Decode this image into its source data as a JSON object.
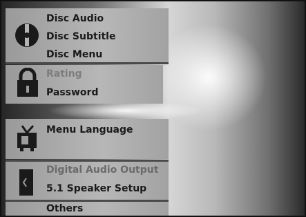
{
  "menu": {
    "disc": {
      "icon": "disc-icon",
      "items": [
        "Disc Audio",
        "Disc Subtitle",
        "Disc Menu"
      ]
    },
    "lock": {
      "icon": "padlock-icon",
      "items": [
        "Rating",
        "Password"
      ]
    },
    "language": {
      "icon": "tv-icon",
      "items": [
        "Menu Language"
      ]
    },
    "audio": {
      "icon": "speaker-icon",
      "items": [
        "Digital Audio Output",
        "5.1 Speaker Setup"
      ]
    },
    "others": {
      "items": [
        "Others"
      ]
    }
  }
}
